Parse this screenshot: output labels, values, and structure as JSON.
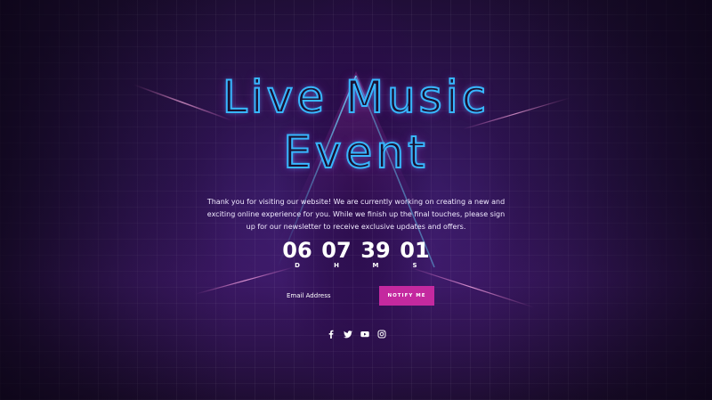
{
  "hero": {
    "title_line1": "Live Music",
    "title_line2": "Event",
    "intro": "Thank you for visiting our website! We are currently working on creating a new and exciting online experience for you. While we finish up the final touches, please sign up for our newsletter to receive exclusive updates and offers."
  },
  "countdown": {
    "days": "06",
    "hours": "07",
    "minutes": "39",
    "seconds": "01",
    "days_label": "D",
    "hours_label": "H",
    "minutes_label": "M",
    "seconds_label": "S"
  },
  "signup": {
    "email_placeholder": "Email Address",
    "button_label": "NOTIFY ME",
    "button_color": "#c4299f"
  },
  "social": {
    "icons": [
      "facebook-icon",
      "twitter-icon",
      "youtube-icon",
      "instagram-icon"
    ]
  },
  "colors": {
    "title_outline": "#38b6ff",
    "title_glow": "#d23cdc",
    "background": "#2a1548"
  }
}
